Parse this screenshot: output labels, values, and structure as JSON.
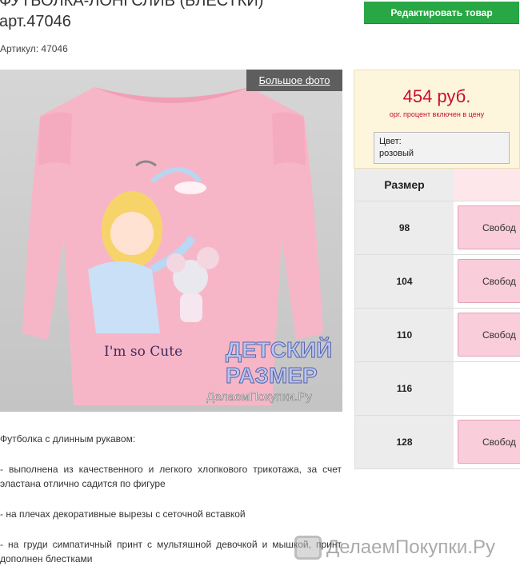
{
  "product": {
    "title_line1": "ФУТБОЛКА-ЛОНГСЛИВ (БЛЕСТКИ)",
    "title_line2": "арт.47046",
    "article": "Артикул: 47046"
  },
  "toolbar": {
    "edit_label": "Редактировать товар"
  },
  "photo": {
    "big_photo_label": "Большое фото",
    "print_text": "I'm so Cute",
    "logo_line1": "ДЕТСКИЙ",
    "logo_line2": "РАЗМЕР",
    "logo_site": "ДелаемПокупки.Ру"
  },
  "pricing": {
    "price": "454 руб.",
    "note": "орг. процент включен в цену",
    "color_label": "Цвет:",
    "color_value": "розовый"
  },
  "sizes": {
    "header": "Размер",
    "rows": [
      {
        "size": "98",
        "status": "Свобод"
      },
      {
        "size": "104",
        "status": "Свобод"
      },
      {
        "size": "110",
        "status": "Свобод"
      },
      {
        "size": "116",
        "status": ""
      },
      {
        "size": "128",
        "status": "Свобод"
      }
    ]
  },
  "description": {
    "paragraphs": [
      "Футболка с длинным рукавом:",
      "- выполнена из качественного и легкого хлопкового трикотажа, за счет эластана отлично садится по фигуре",
      "- на плечах декоративные вырезы с сеточной вставкой",
      "- на груди симпатичный принт с мультяшной девочкой и мышкой, принт дополнен блестками"
    ]
  },
  "watermark": {
    "text": "ДелаемПокупки.Ру"
  },
  "colors": {
    "edit_button": "#28a745",
    "price": "#c8102e",
    "available": "#f9cdd9",
    "shirt": "#f7b6c8"
  }
}
